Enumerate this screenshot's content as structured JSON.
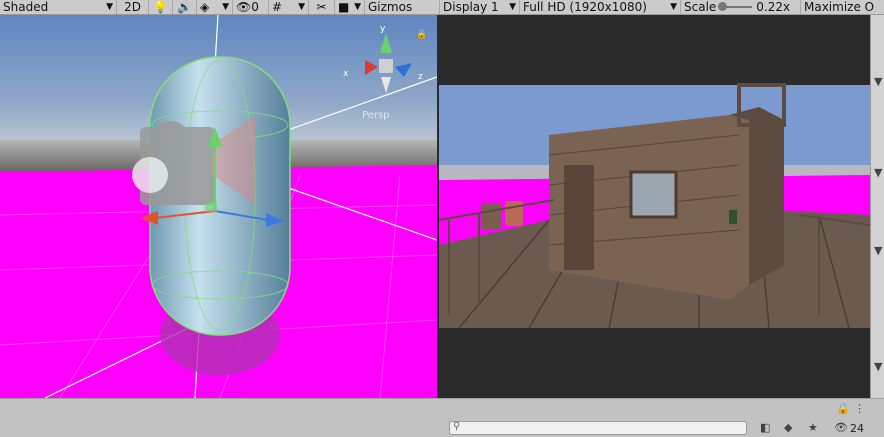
{
  "toolbar": {
    "shading_mode": "Shaded",
    "mode_2d": "2D",
    "hidden_count": "0",
    "gizmos": "Gizmos",
    "display": "Display 1",
    "resolution": "Full HD (1920x1080)",
    "scale_label": "Scale",
    "scale_value": "0.22x",
    "maximize": "Maximize O"
  },
  "scene": {
    "axes": {
      "x": "x",
      "y": "y",
      "z": "z"
    },
    "projection": "Persp"
  },
  "status": {
    "search_placeholder": "",
    "hidden_layers_count": "24"
  },
  "colors": {
    "magenta": "#ff00ff",
    "sky": "#5f86c0",
    "toolbar_bg": "#cbcbcb"
  }
}
